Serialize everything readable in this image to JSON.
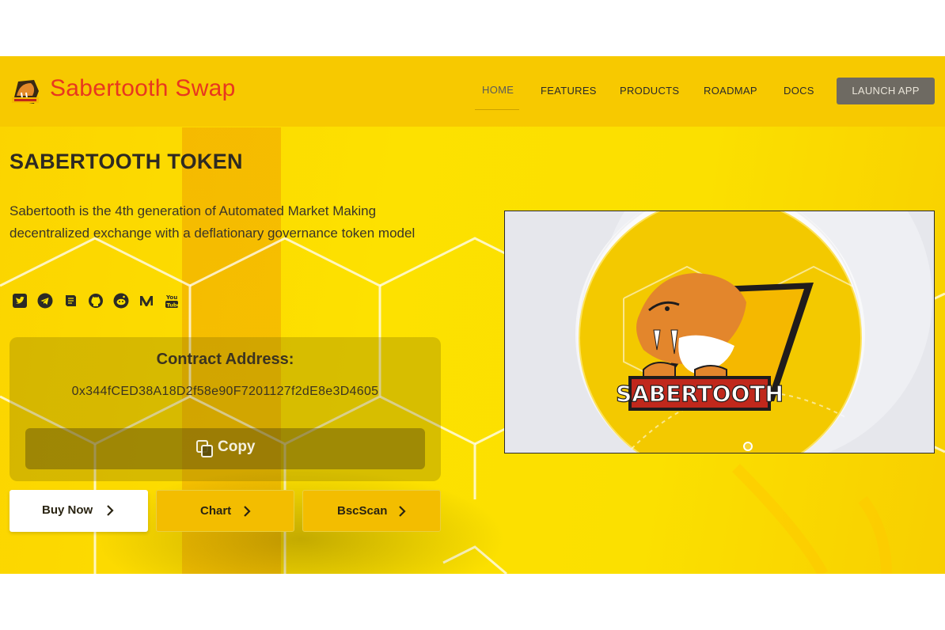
{
  "header": {
    "brand": "Sabertooth Swap",
    "nav": [
      "HOME",
      "FEATURES",
      "PRODUCTS",
      "ROADMAP",
      "DOCS"
    ],
    "launch_label": "LAUNCH APP"
  },
  "hero": {
    "title": "SABERTOOTH TOKEN",
    "description": "Sabertooth is the 4th generation of Automated Market Making decentralized exchange with a deflationary governance token model",
    "socials": [
      "twitter-icon",
      "telegram-icon",
      "docs-icon",
      "github-icon",
      "reddit-icon",
      "medium-icon",
      "youtube-icon"
    ]
  },
  "contract": {
    "title": "Contract Address:",
    "address": "0x344fCED38A18D2f58e90F7201127f2dE8e3D4605",
    "copy_label": "Copy"
  },
  "actions": {
    "buy_label": "Buy Now",
    "chart_label": "Chart",
    "bscscan_label": "BscScan"
  },
  "panel": {
    "logo_text": "SABERTOOTH"
  },
  "colors": {
    "brand_red": "#e8371f",
    "background_yellow": "#fde100",
    "button_yellow": "#f3bd00",
    "launch_gray": "#6e6a62"
  }
}
